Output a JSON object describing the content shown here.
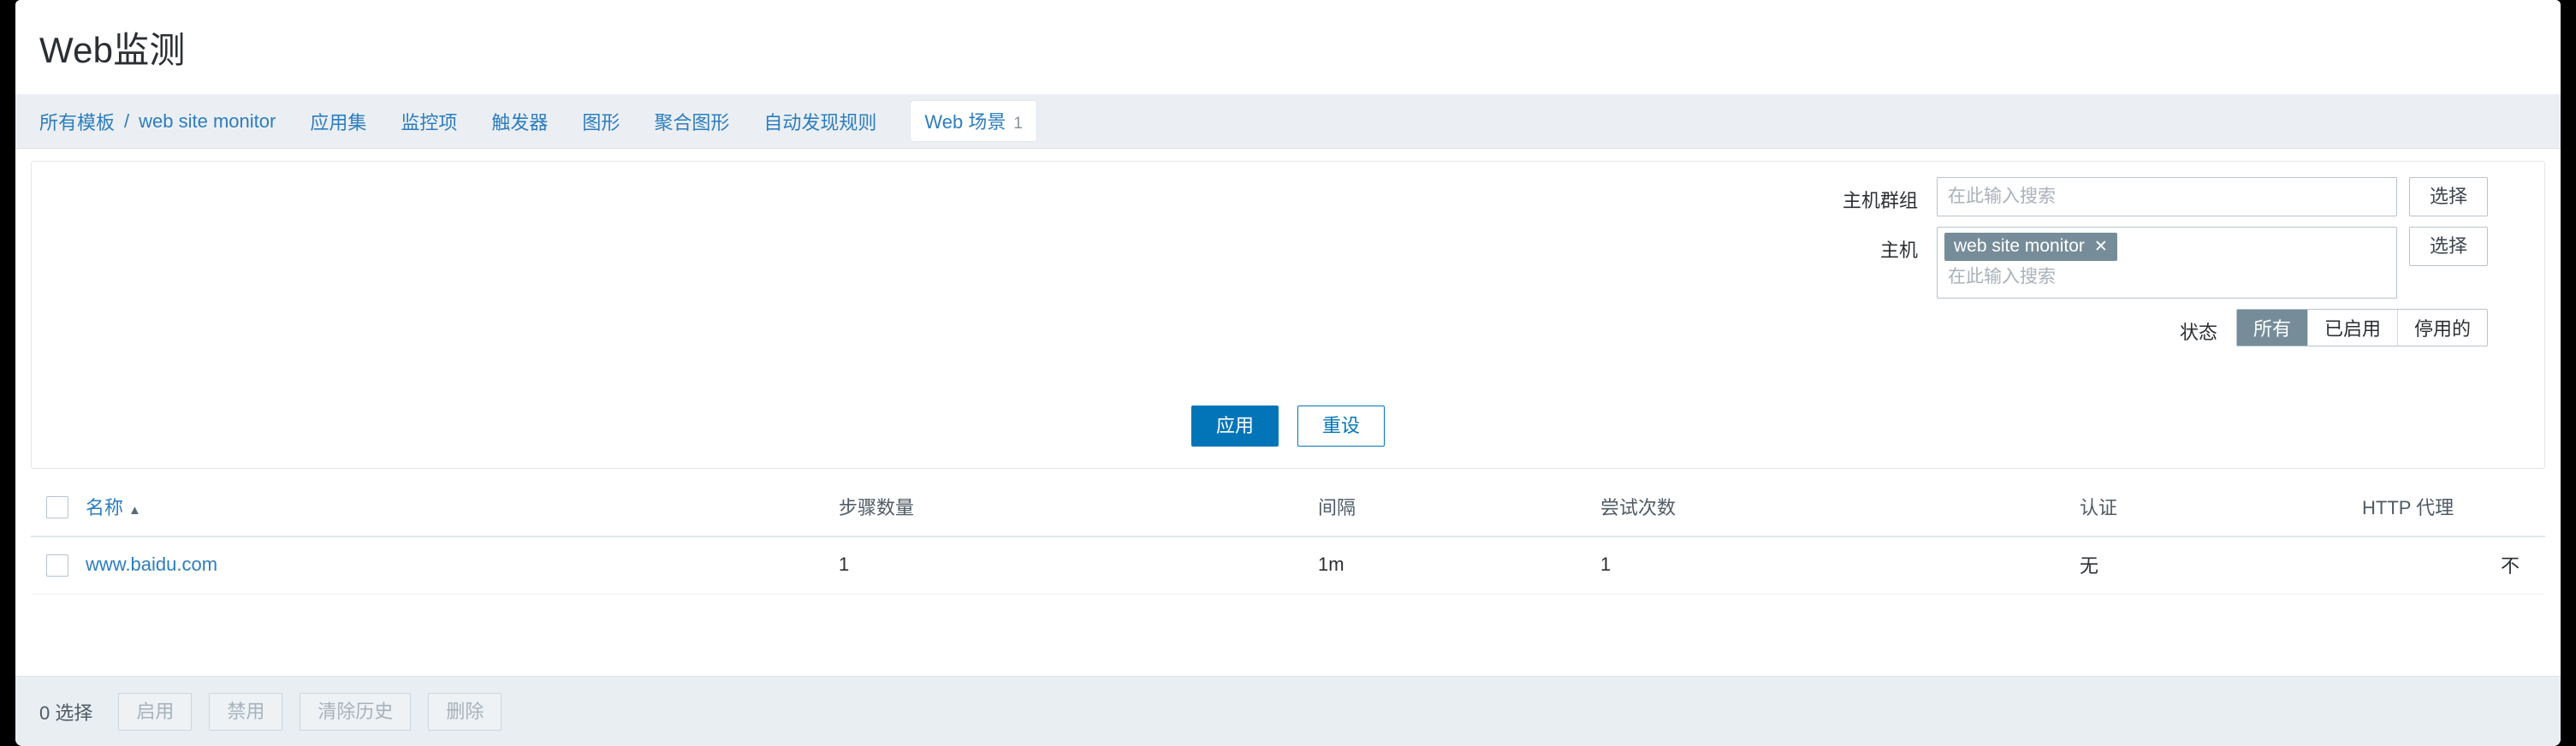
{
  "header": {
    "title": "Web监测"
  },
  "breadcrumb": {
    "root_label": "所有模板",
    "separator": "/",
    "template_label": "web site monitor",
    "tabs": [
      {
        "label": "应用集"
      },
      {
        "label": "监控项"
      },
      {
        "label": "触发器"
      },
      {
        "label": "图形"
      },
      {
        "label": "聚合图形"
      },
      {
        "label": "自动发现规则"
      }
    ],
    "active_tab": {
      "label": "Web 场景",
      "count": "1"
    }
  },
  "filter": {
    "host_group": {
      "label": "主机群组",
      "placeholder": "在此输入搜索",
      "value": "",
      "select_button": "选择"
    },
    "host": {
      "label": "主机",
      "placeholder": "在此输入搜索",
      "chips": [
        {
          "label": "web site monitor",
          "remove_icon": "✕"
        }
      ],
      "select_button": "选择"
    },
    "status": {
      "label": "状态",
      "options": [
        "所有",
        "已启用",
        "停用的"
      ],
      "selected": "所有"
    },
    "apply_button": "应用",
    "reset_button": "重设"
  },
  "table": {
    "columns": [
      {
        "key": "name",
        "label": "名称",
        "sorted": true,
        "sort_icon": "▲"
      },
      {
        "key": "steps",
        "label": "步骤数量"
      },
      {
        "key": "interval",
        "label": "间隔"
      },
      {
        "key": "attempts",
        "label": "尝试次数"
      },
      {
        "key": "auth",
        "label": "认证"
      },
      {
        "key": "proxy",
        "label": "HTTP 代理"
      }
    ],
    "rows": [
      {
        "name": "www.baidu.com",
        "steps": "1",
        "interval": "1m",
        "attempts": "1",
        "auth": "无",
        "proxy": "不"
      }
    ]
  },
  "footer": {
    "selected_text": "0 选择",
    "buttons": [
      {
        "label": "启用"
      },
      {
        "label": "禁用"
      },
      {
        "label": "清除历史"
      },
      {
        "label": "删除"
      }
    ]
  },
  "colors": {
    "accent_blue": "#0275b8",
    "link_blue": "#2d7dbf",
    "chip_gray": "#768d99",
    "strip_bg": "#ebeff3",
    "footer_bg": "#e8eef2"
  }
}
